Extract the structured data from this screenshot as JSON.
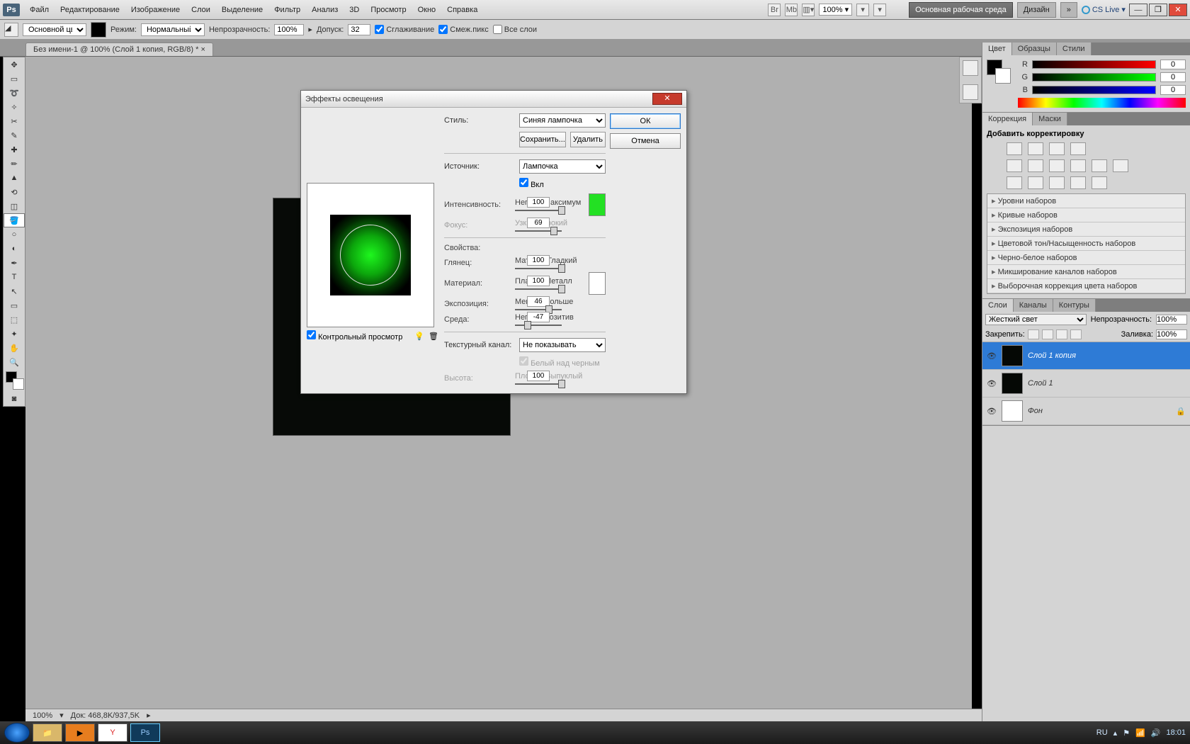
{
  "menubar": {
    "items": [
      "Файл",
      "Редактирование",
      "Изображение",
      "Слои",
      "Выделение",
      "Фильтр",
      "Анализ",
      "3D",
      "Просмотр",
      "Окно",
      "Справка"
    ],
    "zoom": "100%",
    "workspaces": {
      "primary": "Основная рабочая среда",
      "design": "Дизайн"
    },
    "cslive": "CS Live"
  },
  "options": {
    "set_label": "Основной цвет",
    "mode_label": "Режим:",
    "mode_value": "Нормальный",
    "opacity_label": "Непрозрачность:",
    "opacity_value": "100%",
    "tol_label": "Допуск:",
    "tol_value": "32",
    "antialias": "Сглаживание",
    "contig": "Смеж.пикс",
    "alllayers": "Все слои"
  },
  "doc_tab": "Без имени-1 @ 100% (Слой 1 копия, RGB/8) *",
  "status": {
    "zoom": "100%",
    "doc": "Док: 468,8K/937,5K"
  },
  "color_panel": {
    "tabs": [
      "Цвет",
      "Образцы",
      "Стили"
    ],
    "R": "0",
    "G": "0",
    "B": "0"
  },
  "corr_panel": {
    "tabs": [
      "Коррекция",
      "Маски"
    ],
    "title": "Добавить корректировку",
    "presets": [
      "Уровни наборов",
      "Кривые наборов",
      "Экспозиция наборов",
      "Цветовой тон/Насыщенность наборов",
      "Черно-белое наборов",
      "Микширование каналов наборов",
      "Выборочная коррекция цвета наборов"
    ]
  },
  "layers_panel": {
    "tabs": [
      "Слои",
      "Каналы",
      "Контуры"
    ],
    "blend": "Жесткий свет",
    "opacity_label": "Непрозрачность:",
    "opacity": "100%",
    "lock_label": "Закрепить:",
    "fill_label": "Заливка:",
    "fill": "100%",
    "layers": [
      {
        "name": "Слой 1 копия"
      },
      {
        "name": "Слой 1"
      },
      {
        "name": "Фон"
      }
    ]
  },
  "dialog": {
    "title": "Эффекты освещения",
    "ok": "ОК",
    "cancel": "Отмена",
    "style_label": "Стиль:",
    "style": "Синяя лампочка",
    "save": "Сохранить...",
    "delete": "Удалить",
    "source_label": "Источник:",
    "source": "Лампочка",
    "on": "Вкл",
    "intensity_label": "Интенсивность:",
    "intensity": {
      "lo": "Негатив",
      "hi": "Максимум",
      "val": "100"
    },
    "focus_label": "Фокус:",
    "focus": {
      "lo": "Узкий",
      "hi": "Широкий",
      "val": "69"
    },
    "props": "Свойства:",
    "gloss_label": "Глянец:",
    "gloss": {
      "lo": "Матовый",
      "hi": "Гладкий",
      "val": "100"
    },
    "material_label": "Материал:",
    "material": {
      "lo": "Пластик",
      "hi": "Металл",
      "val": "100"
    },
    "exposure_label": "Экспозиция:",
    "exposure": {
      "lo": "Меньше",
      "hi": "Больше",
      "val": "46"
    },
    "ambience_label": "Среда:",
    "ambience": {
      "lo": "Негатив",
      "hi": "Позитив",
      "val": "-47"
    },
    "texchan_label": "Текстурный канал:",
    "texchan": "Не показывать",
    "whiteHigh": "Белый над черным",
    "height_label": "Высота:",
    "height": {
      "lo": "Плоский",
      "hi": "Выпуклый",
      "val": "100"
    },
    "preview_cb": "Контрольный просмотр",
    "light_color": "#23e023",
    "amb_color": "#ffffff"
  },
  "taskbar": {
    "lang": "RU",
    "time": "18:01"
  }
}
